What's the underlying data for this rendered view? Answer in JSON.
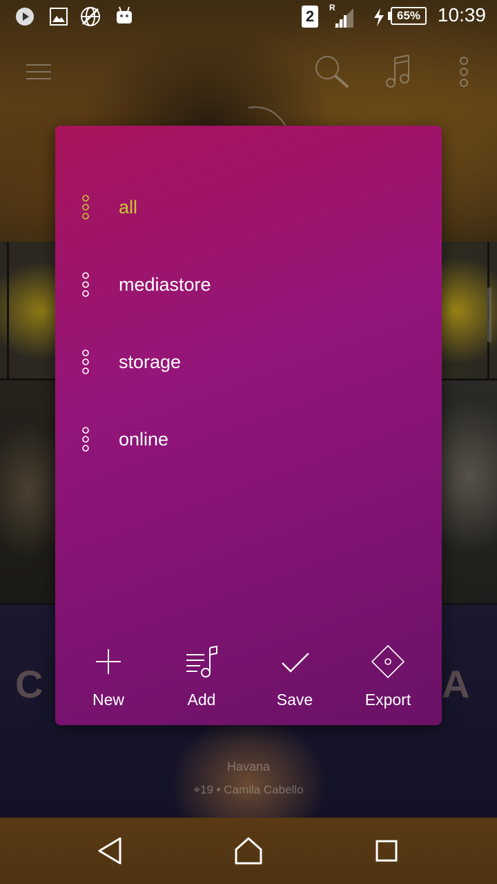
{
  "status_bar": {
    "time": "10:39",
    "battery": "65%",
    "sim_slot": "2",
    "roaming": "R",
    "icons": [
      "play-icon",
      "image-icon",
      "vpn-globe-icon",
      "android-icon",
      "signal-icon",
      "charging-icon",
      "battery-icon"
    ]
  },
  "background_app": {
    "header_icons": [
      "menu-icon",
      "search-icon",
      "music-note-icon",
      "overflow-menu-icon"
    ],
    "album_text_left": "C",
    "album_text_right": "A",
    "now_playing": {
      "title": "Havana",
      "subtitle": "⌖19 • Camila Cabello"
    }
  },
  "dialog": {
    "items": [
      {
        "label": "all",
        "active": true
      },
      {
        "label": "mediastore",
        "active": false
      },
      {
        "label": "storage",
        "active": false
      },
      {
        "label": "online",
        "active": false
      }
    ],
    "actions": [
      {
        "label": "New",
        "icon": "plus-icon"
      },
      {
        "label": "Add",
        "icon": "add-to-playlist-icon"
      },
      {
        "label": "Save",
        "icon": "check-icon"
      },
      {
        "label": "Export",
        "icon": "export-diamond-icon"
      }
    ],
    "colors": {
      "gradient_start": "#a8145a",
      "gradient_end": "#6a1266",
      "active_item": "#c8c832",
      "text": "#ffffff"
    }
  },
  "nav_bar": {
    "buttons": [
      "back-icon",
      "home-icon",
      "recents-icon"
    ]
  }
}
